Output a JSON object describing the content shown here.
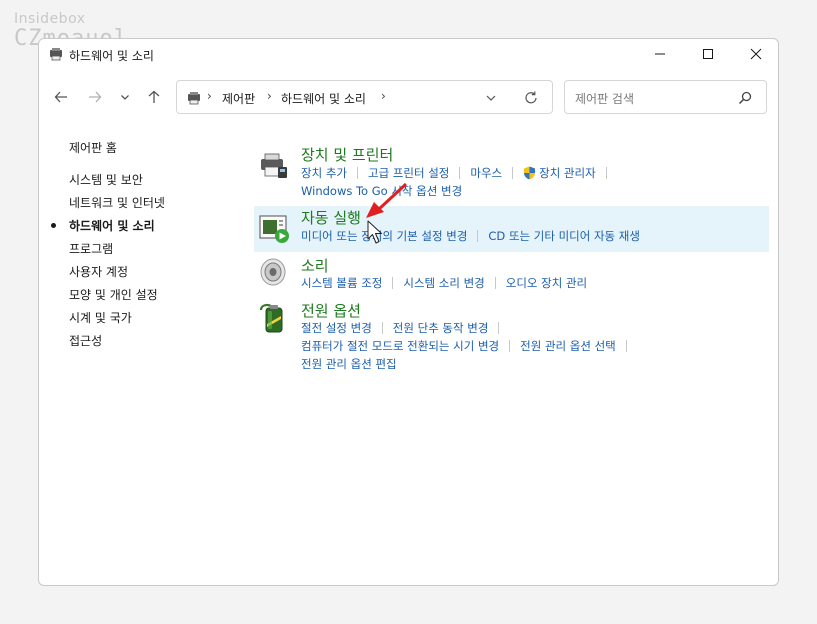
{
  "watermark": {
    "line1": "Insidebox",
    "line2": "CZmoauol"
  },
  "window": {
    "title": "하드웨어 및 소리",
    "controls": {
      "minimize": "minimize-icon",
      "maximize": "maximize-icon",
      "close": "close-icon"
    }
  },
  "nav": {
    "breadcrumb": [
      "제어판",
      "하드웨어 및 소리"
    ],
    "search_placeholder": "제어판 검색"
  },
  "sidebar": {
    "home": "제어판 홈",
    "items": [
      {
        "label": "시스템 및 보안",
        "current": false
      },
      {
        "label": "네트워크 및 인터넷",
        "current": false
      },
      {
        "label": "하드웨어 및 소리",
        "current": true
      },
      {
        "label": "프로그램",
        "current": false
      },
      {
        "label": "사용자 계정",
        "current": false
      },
      {
        "label": "모양 및 개인 설정",
        "current": false
      },
      {
        "label": "시계 및 국가",
        "current": false
      },
      {
        "label": "접근성",
        "current": false
      }
    ]
  },
  "categories": [
    {
      "title": "장치 및 프린터",
      "rows": [
        [
          "장치 추가",
          "고급 프린터 설정",
          "마우스",
          "장치 관리자"
        ],
        [
          "Windows To Go 시작 옵션 변경"
        ]
      ]
    },
    {
      "title": "자동 실행",
      "rows": [
        [
          "미디어 또는 장치의 기본 설정 변경",
          "CD 또는 기타 미디어 자동 재생"
        ]
      ]
    },
    {
      "title": "소리",
      "rows": [
        [
          "시스템 볼륨 조정",
          "시스템 소리 변경",
          "오디오 장치 관리"
        ]
      ]
    },
    {
      "title": "전원 옵션",
      "rows": [
        [
          "절전 설정 변경",
          "전원 단추 동작 변경"
        ],
        [
          "컴퓨터가 절전 모드로 전환되는 시기 변경",
          "전원 관리 옵션 선택"
        ],
        [
          "전원 관리 옵션 편집"
        ]
      ]
    }
  ],
  "colors": {
    "category_title": "#1e7a1e",
    "link": "#1b5eab",
    "highlight": "#e5f3fb",
    "annotation_arrow": "#e02020"
  }
}
